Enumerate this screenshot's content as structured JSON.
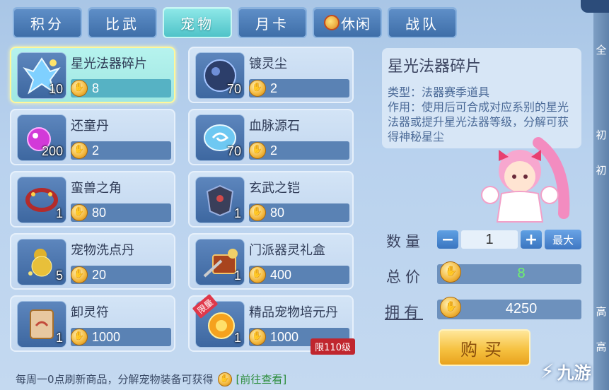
{
  "tabs": [
    {
      "label": "积分",
      "active": false
    },
    {
      "label": "比武",
      "active": false
    },
    {
      "label": "宠物",
      "active": true
    },
    {
      "label": "月卡",
      "active": false
    },
    {
      "label": "休闲",
      "active": false,
      "icon": "trophy-icon"
    },
    {
      "label": "战队",
      "active": false
    }
  ],
  "items": [
    {
      "name": "星光法器碎片",
      "qty": "10",
      "price": "8",
      "icon": "crystal-shard-icon",
      "selected": true
    },
    {
      "name": "镀灵尘",
      "qty": "70",
      "price": "2",
      "icon": "dark-orb-icon"
    },
    {
      "name": "还童丹",
      "qty": "200",
      "price": "2",
      "icon": "pink-pill-icon"
    },
    {
      "name": "血脉源石",
      "qty": "70",
      "price": "2",
      "icon": "swirl-stone-icon"
    },
    {
      "name": "蛮兽之角",
      "qty": "1",
      "price": "80",
      "icon": "horn-collar-icon"
    },
    {
      "name": "玄武之铠",
      "qty": "1",
      "price": "80",
      "icon": "armor-icon"
    },
    {
      "name": "宠物洗点丹",
      "qty": "5",
      "price": "20",
      "icon": "gourd-icon"
    },
    {
      "name": "门派器灵礼盒",
      "qty": "1",
      "price": "400",
      "icon": "treasure-chest-icon"
    },
    {
      "name": "卸灵符",
      "qty": "1",
      "price": "1000",
      "icon": "scroll-icon"
    },
    {
      "name": "精品宠物培元丹",
      "qty": "1",
      "price": "1000",
      "icon": "golden-pill-icon",
      "ribbon": "限量",
      "limit": "限110级"
    }
  ],
  "detail": {
    "title": "星光法器碎片",
    "description": "类型：法器赛季道具\n作用：使用后可合成对应系别的星光法器或提升星光法器等级，分解可获得神秘星尘"
  },
  "purchase": {
    "qty_label": "数量",
    "qty_value": "1",
    "minus": "−",
    "plus": "+",
    "max_label": "最大",
    "total_label": "总价",
    "total_value": "8",
    "own_label": "拥有",
    "own_value": "4250",
    "buy_label": "购买"
  },
  "footer": {
    "text": "每周一0点刷新商品，分解宠物装备可获得",
    "link": "[前往查看]"
  },
  "watermark": "九游",
  "colors": {
    "active_tab": "#4fc3c8",
    "price_green": "#6ff56a",
    "buy_button": "#f6c241"
  }
}
